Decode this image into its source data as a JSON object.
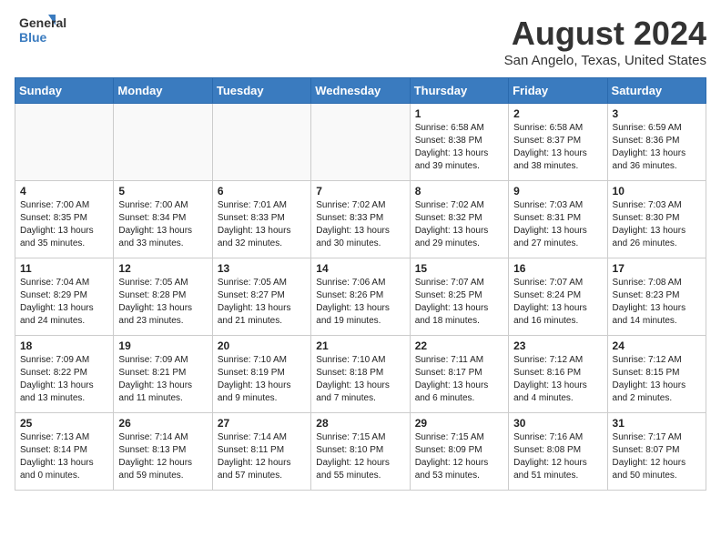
{
  "header": {
    "logo_line1": "General",
    "logo_line2": "Blue",
    "main_title": "August 2024",
    "subtitle": "San Angelo, Texas, United States"
  },
  "calendar": {
    "days_of_week": [
      "Sunday",
      "Monday",
      "Tuesday",
      "Wednesday",
      "Thursday",
      "Friday",
      "Saturday"
    ],
    "weeks": [
      [
        {
          "day": "",
          "info": ""
        },
        {
          "day": "",
          "info": ""
        },
        {
          "day": "",
          "info": ""
        },
        {
          "day": "",
          "info": ""
        },
        {
          "day": "1",
          "info": "Sunrise: 6:58 AM\nSunset: 8:38 PM\nDaylight: 13 hours\nand 39 minutes."
        },
        {
          "day": "2",
          "info": "Sunrise: 6:58 AM\nSunset: 8:37 PM\nDaylight: 13 hours\nand 38 minutes."
        },
        {
          "day": "3",
          "info": "Sunrise: 6:59 AM\nSunset: 8:36 PM\nDaylight: 13 hours\nand 36 minutes."
        }
      ],
      [
        {
          "day": "4",
          "info": "Sunrise: 7:00 AM\nSunset: 8:35 PM\nDaylight: 13 hours\nand 35 minutes."
        },
        {
          "day": "5",
          "info": "Sunrise: 7:00 AM\nSunset: 8:34 PM\nDaylight: 13 hours\nand 33 minutes."
        },
        {
          "day": "6",
          "info": "Sunrise: 7:01 AM\nSunset: 8:33 PM\nDaylight: 13 hours\nand 32 minutes."
        },
        {
          "day": "7",
          "info": "Sunrise: 7:02 AM\nSunset: 8:33 PM\nDaylight: 13 hours\nand 30 minutes."
        },
        {
          "day": "8",
          "info": "Sunrise: 7:02 AM\nSunset: 8:32 PM\nDaylight: 13 hours\nand 29 minutes."
        },
        {
          "day": "9",
          "info": "Sunrise: 7:03 AM\nSunset: 8:31 PM\nDaylight: 13 hours\nand 27 minutes."
        },
        {
          "day": "10",
          "info": "Sunrise: 7:03 AM\nSunset: 8:30 PM\nDaylight: 13 hours\nand 26 minutes."
        }
      ],
      [
        {
          "day": "11",
          "info": "Sunrise: 7:04 AM\nSunset: 8:29 PM\nDaylight: 13 hours\nand 24 minutes."
        },
        {
          "day": "12",
          "info": "Sunrise: 7:05 AM\nSunset: 8:28 PM\nDaylight: 13 hours\nand 23 minutes."
        },
        {
          "day": "13",
          "info": "Sunrise: 7:05 AM\nSunset: 8:27 PM\nDaylight: 13 hours\nand 21 minutes."
        },
        {
          "day": "14",
          "info": "Sunrise: 7:06 AM\nSunset: 8:26 PM\nDaylight: 13 hours\nand 19 minutes."
        },
        {
          "day": "15",
          "info": "Sunrise: 7:07 AM\nSunset: 8:25 PM\nDaylight: 13 hours\nand 18 minutes."
        },
        {
          "day": "16",
          "info": "Sunrise: 7:07 AM\nSunset: 8:24 PM\nDaylight: 13 hours\nand 16 minutes."
        },
        {
          "day": "17",
          "info": "Sunrise: 7:08 AM\nSunset: 8:23 PM\nDaylight: 13 hours\nand 14 minutes."
        }
      ],
      [
        {
          "day": "18",
          "info": "Sunrise: 7:09 AM\nSunset: 8:22 PM\nDaylight: 13 hours\nand 13 minutes."
        },
        {
          "day": "19",
          "info": "Sunrise: 7:09 AM\nSunset: 8:21 PM\nDaylight: 13 hours\nand 11 minutes."
        },
        {
          "day": "20",
          "info": "Sunrise: 7:10 AM\nSunset: 8:19 PM\nDaylight: 13 hours\nand 9 minutes."
        },
        {
          "day": "21",
          "info": "Sunrise: 7:10 AM\nSunset: 8:18 PM\nDaylight: 13 hours\nand 7 minutes."
        },
        {
          "day": "22",
          "info": "Sunrise: 7:11 AM\nSunset: 8:17 PM\nDaylight: 13 hours\nand 6 minutes."
        },
        {
          "day": "23",
          "info": "Sunrise: 7:12 AM\nSunset: 8:16 PM\nDaylight: 13 hours\nand 4 minutes."
        },
        {
          "day": "24",
          "info": "Sunrise: 7:12 AM\nSunset: 8:15 PM\nDaylight: 13 hours\nand 2 minutes."
        }
      ],
      [
        {
          "day": "25",
          "info": "Sunrise: 7:13 AM\nSunset: 8:14 PM\nDaylight: 13 hours\nand 0 minutes."
        },
        {
          "day": "26",
          "info": "Sunrise: 7:14 AM\nSunset: 8:13 PM\nDaylight: 12 hours\nand 59 minutes."
        },
        {
          "day": "27",
          "info": "Sunrise: 7:14 AM\nSunset: 8:11 PM\nDaylight: 12 hours\nand 57 minutes."
        },
        {
          "day": "28",
          "info": "Sunrise: 7:15 AM\nSunset: 8:10 PM\nDaylight: 12 hours\nand 55 minutes."
        },
        {
          "day": "29",
          "info": "Sunrise: 7:15 AM\nSunset: 8:09 PM\nDaylight: 12 hours\nand 53 minutes."
        },
        {
          "day": "30",
          "info": "Sunrise: 7:16 AM\nSunset: 8:08 PM\nDaylight: 12 hours\nand 51 minutes."
        },
        {
          "day": "31",
          "info": "Sunrise: 7:17 AM\nSunset: 8:07 PM\nDaylight: 12 hours\nand 50 minutes."
        }
      ]
    ]
  }
}
